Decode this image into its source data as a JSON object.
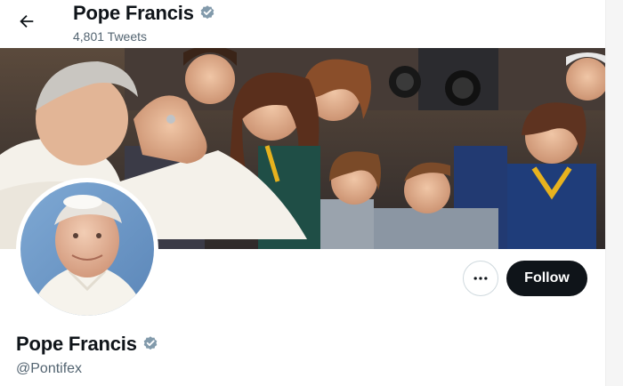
{
  "header": {
    "back_icon": "arrow-left-icon",
    "name": "Pope Francis",
    "tweet_count": "4,801 Tweets",
    "verified_icon": "verified-badge-icon"
  },
  "banner": {
    "description": "Crowd of cheering young people photographing a pope in white"
  },
  "profile": {
    "name": "Pope Francis",
    "handle": "@Pontifex",
    "verified_icon": "verified-badge-icon",
    "avatar_icon": "avatar-icon"
  },
  "actions": {
    "more_icon": "more-dots-icon",
    "follow_label": "Follow"
  },
  "colors": {
    "text": "#0f1419",
    "secondary_text": "#536471",
    "verified_gray": "#829aab",
    "follow_bg": "#0f1419"
  }
}
